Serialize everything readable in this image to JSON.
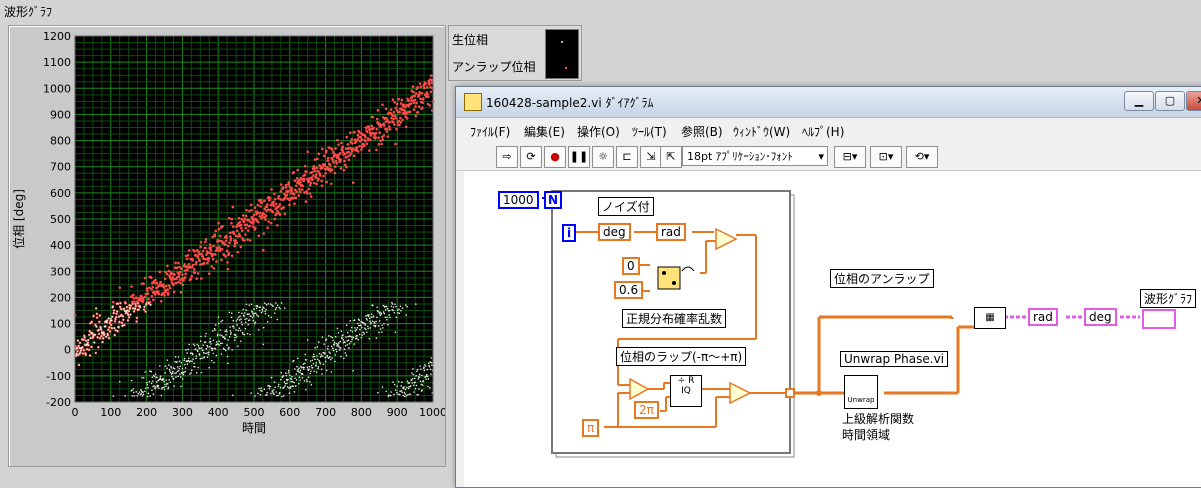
{
  "front_panel": {
    "graph_title": "波形ｸﾞﾗﾌ",
    "legend": {
      "wrapped_label": "生位相",
      "unwrapped_label": "アンラップ位相"
    }
  },
  "chart_data": {
    "type": "scatter",
    "xlabel": "時間",
    "ylabel": "位相 [deg]",
    "xlim": [
      0,
      1000
    ],
    "ylim": [
      -200,
      1200
    ],
    "x_ticks": [
      "0",
      "100",
      "200",
      "300",
      "400",
      "500",
      "600",
      "700",
      "800",
      "900",
      "1000"
    ],
    "y_ticks": [
      "-200",
      "-100",
      "0",
      "100",
      "200",
      "300",
      "400",
      "500",
      "600",
      "700",
      "800",
      "900",
      "1000",
      "1100",
      "1200"
    ],
    "grid": true,
    "series": [
      {
        "name": "アンラップ位相",
        "color": "#ff4a4a",
        "trend": {
          "x": [
            0,
            1000
          ],
          "y": [
            0,
            1000
          ]
        },
        "noise_sd": 34
      },
      {
        "name": "生位相",
        "color": "#e8f0e0",
        "wrap": {
          "low": -180,
          "high": 180
        }
      }
    ]
  },
  "diagram": {
    "window_title": "160428-sample2.vi ﾀﾞｲｱｸﾞﾗﾑ",
    "menu": [
      "ﾌｧｲﾙ(F)",
      "編集(E)",
      "操作(O)",
      "ﾂｰﾙ(T)",
      "参照(B)",
      "ｳｨﾝﾄﾞｳ(W)",
      "ﾍﾙﾌﾟ(H)"
    ],
    "font_select": "18pt ｱﾌﾟﾘｹｰｼｮﾝ･ﾌｫﾝﾄ",
    "loop_count": "1000",
    "loop_n": "N",
    "loop_i": "i",
    "noise_label": "ノイズ付",
    "deg_label": "deg",
    "rad_label": "rad",
    "const_zero": "0",
    "const_06": "0.6",
    "random_label": "正規分布確率乱数",
    "wrap_label": "位相のラップ(-π〜+π)",
    "pi_const": "π",
    "two_pi_const": "2π",
    "unwrap_title": "位相のアンラップ",
    "unwrap_vi": "Unwrap Phase.vi",
    "unwrap_icon_text": "Unwrap",
    "category_label": "上級解析関数\n時間領域",
    "out_rad": "rad",
    "out_deg": "deg",
    "graph_terminal": "波形ｸﾞﾗﾌ"
  }
}
